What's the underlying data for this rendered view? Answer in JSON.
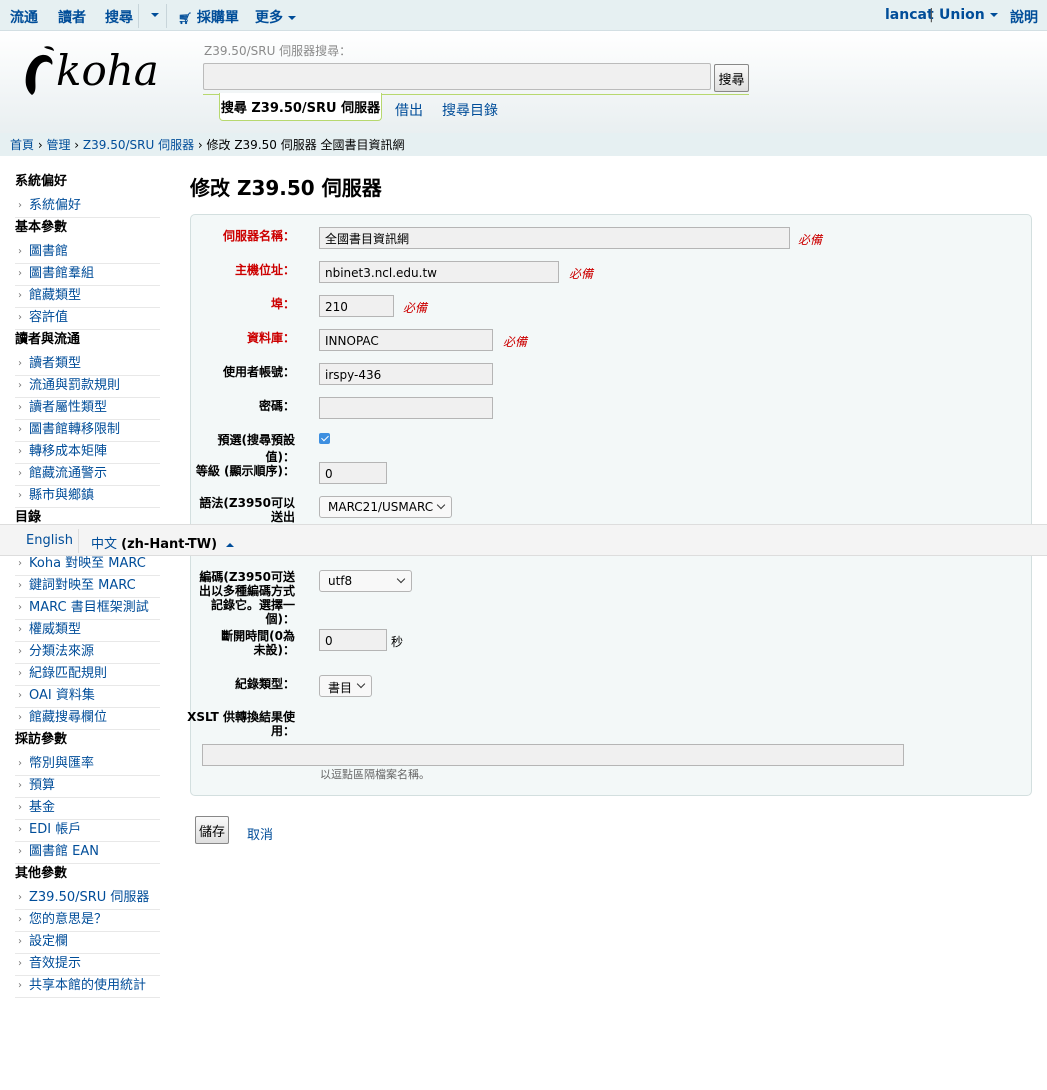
{
  "topnav": {
    "circulation": "流通",
    "patrons": "讀者",
    "search": "搜尋",
    "cart": "採購單",
    "more": "更多",
    "user": "lancat",
    "library": "Union",
    "help": "說明"
  },
  "header": {
    "search_label": "Z39.50/SRU 伺服器搜尋：",
    "search_button": "搜尋",
    "tab_active": "搜尋 Z39.50/SRU 伺服器",
    "tab_checkout": "借出",
    "tab_catalog": "搜尋目錄"
  },
  "breadcrumb": {
    "home": "首頁",
    "admin": "管理",
    "z3950": "Z39.50/SRU 伺服器",
    "current": "修改 Z39.50 伺服器 全國書目資訊網"
  },
  "sidebar": {
    "sections": [
      {
        "title": "系統偏好",
        "items": [
          "系統偏好"
        ]
      },
      {
        "title": "基本參數",
        "items": [
          "圖書館",
          "圖書館羣組",
          "館藏類型",
          "容許值"
        ]
      },
      {
        "title": "讀者與流通",
        "items": [
          "讀者類型",
          "流通與罰款規則",
          "讀者屬性類型",
          "圖書館轉移限制",
          "轉移成本矩陣",
          "館藏流通警示",
          "縣市與鄉鎮"
        ]
      },
      {
        "title": "目錄",
        "items": [
          "Koha 對映至 MARC",
          "Koha 對映至 MARC",
          "鍵詞對映至 MARC",
          "MARC 書目框架測試",
          "權威類型",
          "分類法來源",
          "紀錄匹配規則",
          "OAI 資料集",
          "館藏搜尋欄位"
        ]
      },
      {
        "title": "採訪參數",
        "items": [
          "幣別與匯率",
          "預算",
          "基金",
          "EDI 帳戶",
          "圖書館 EAN"
        ]
      },
      {
        "title": "其他參數",
        "items": [
          "Z39.50/SRU 伺服器",
          "您的意思是？",
          "設定欄",
          "音效提示",
          "共享本館的使用統計"
        ]
      }
    ]
  },
  "page_title": "修改 Z39.50 伺服器",
  "form": {
    "required": "必備",
    "server_name_label": "伺服器名稱：",
    "server_name": "全國書目資訊網",
    "host_label": "主機位址：",
    "host": "nbinet3.ncl.edu.tw",
    "port_label": "埠：",
    "port": "210",
    "database_label": "資料庫：",
    "database": "INNOPAC",
    "userid_label": "使用者帳號：",
    "userid": "irspy-436",
    "password_label": "密碼：",
    "password": "",
    "preselected_label": "預選(搜尋預設值)：",
    "rank_label": "等級 (顯示順序)：",
    "rank": "0",
    "syntax_label": "語法(Z3950可以送出",
    "syntax": "MARC21/USMARC",
    "encoding_label": "編碼(Z3950可送出以多種編碼方式記錄它。選擇一個)：",
    "encoding": "utf8",
    "timeout_label": "斷開時間(0為未設)：",
    "timeout": "0",
    "timeout_unit": "秒",
    "record_type_label": "紀錄類型：",
    "record_type": "書目",
    "xslt_label": "XSLT 供轉換結果使用：",
    "xslt": "",
    "xslt_hint": "以逗點區隔檔案名稱。",
    "save": "儲存",
    "cancel": "取消"
  },
  "langbar": {
    "english": "English",
    "chinese": "中文",
    "chinese_code": "(zh-Hant-TW)"
  }
}
